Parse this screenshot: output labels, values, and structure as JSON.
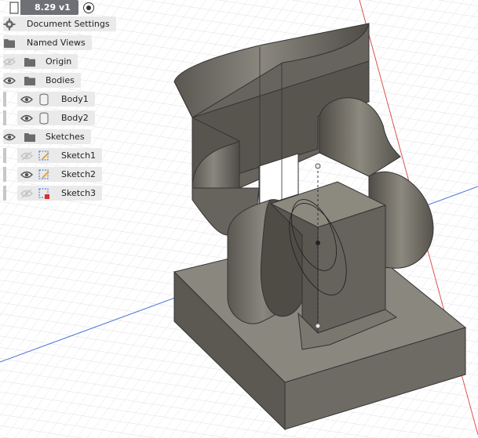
{
  "document": {
    "version": "8.29 v1"
  },
  "browser": {
    "items": [
      {
        "label": "Document Settings",
        "icon": "gear-icon"
      },
      {
        "label": "Named Views",
        "icon": "folder-icon"
      },
      {
        "label": "Origin",
        "icon": "folder-icon",
        "visible": false
      },
      {
        "label": "Bodies",
        "icon": "folder-icon",
        "visible": true
      },
      {
        "label": "Body1",
        "icon": "body-icon",
        "visible": true
      },
      {
        "label": "Body2",
        "icon": "body-icon",
        "visible": true
      },
      {
        "label": "Sketches",
        "icon": "folder-icon",
        "visible": true
      },
      {
        "label": "Sketch1",
        "icon": "sketch-icon",
        "visible": false
      },
      {
        "label": "Sketch2",
        "icon": "sketch-icon",
        "visible": true
      },
      {
        "label": "Sketch3",
        "icon": "sketch-error-icon",
        "visible": false
      }
    ]
  },
  "colors": {
    "model": "#6b6860",
    "grid": "#d4d4d4",
    "axis_x": "#e05050",
    "axis_y": "#4f73d6"
  }
}
